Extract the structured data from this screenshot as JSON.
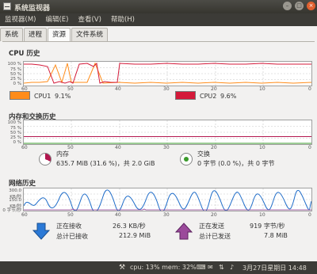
{
  "window": {
    "title": "系统监视器"
  },
  "menu": [
    "监视器(M)",
    "编辑(E)",
    "查看(V)",
    "帮助(H)"
  ],
  "tabs": [
    {
      "label": "系统",
      "active": false
    },
    {
      "label": "进程",
      "active": false
    },
    {
      "label": "资源",
      "active": true
    },
    {
      "label": "文件系统",
      "active": false
    }
  ],
  "cpu": {
    "title": "CPU 历史",
    "y_ticks": [
      "100 %",
      "75 %",
      "50 %",
      "25 %",
      "0 %"
    ],
    "x_ticks": [
      "60",
      "50",
      "40",
      "30",
      "20",
      "10",
      "0"
    ],
    "legend": [
      {
        "label": "CPU1",
        "value": "9.1%",
        "color": "#ff8c1a"
      },
      {
        "label": "CPU2",
        "value": "9.6%",
        "color": "#d41a3a"
      }
    ]
  },
  "mem": {
    "title": "内存和交换历史",
    "y_ticks": [
      "100 %",
      "75 %",
      "50 %",
      "25 %",
      "0 %"
    ],
    "x_ticks": [
      "60",
      "50",
      "40",
      "30",
      "20",
      "10",
      "0"
    ],
    "memory": {
      "label": "内存",
      "value": "635.7 MiB (31.6 %)，共 2.0 GiB",
      "color": "#b3164f"
    },
    "swap": {
      "label": "交换",
      "value": "0 字节 (0.0 %)，共 0 字节",
      "color": "#3a9a2a"
    }
  },
  "net": {
    "title": "网络历史",
    "y_ticks": [
      "300.0 KB/秒",
      "150.0 KB/秒",
      "0 字节/秒"
    ],
    "x_ticks": [
      "60",
      "50",
      "40",
      "30",
      "20",
      "10",
      "0"
    ],
    "receiving_label": "正在接收",
    "receiving_value": "26.3 KB/秒",
    "received_label": "总计已接收",
    "received_value": "212.9 MiB",
    "sending_label": "正在发送",
    "sending_value": "919 字节/秒",
    "sent_label": "总计已发送",
    "sent_value": "7.8 MiB",
    "recv_color": "#1e6cc9",
    "send_color": "#8e3a8e"
  },
  "statusbar": {
    "cpu_mem": "cpu: 13% mem: 32%",
    "clock": "3月27日星期日 14:48"
  }
}
